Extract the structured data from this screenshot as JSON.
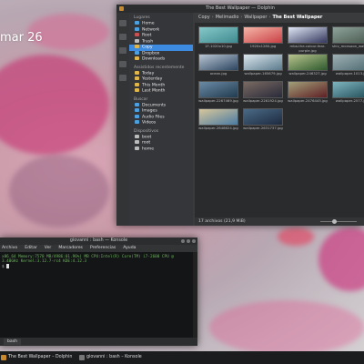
{
  "desktop": {
    "date_label": "mar 26"
  },
  "dolphin": {
    "title": "The Best Wallpaper — Dolphin",
    "places": [
      {
        "section": "Lugares",
        "items": [
          {
            "label": "Home",
            "icon": "home-icon",
            "color": "blue"
          },
          {
            "label": "Network",
            "icon": "network-icon",
            "color": "blue"
          },
          {
            "label": "Root",
            "icon": "root-folder-icon",
            "color": "red"
          },
          {
            "label": "Trash",
            "icon": "trash-icon",
            "color": "grey"
          },
          {
            "label": "Copy",
            "icon": "folder-icon",
            "color": "yellow",
            "selected": true
          },
          {
            "label": "Dropbox",
            "icon": "dropbox-icon",
            "color": "blue"
          },
          {
            "label": "Downloads",
            "icon": "downloads-icon",
            "color": "yellow"
          }
        ]
      },
      {
        "section": "Assistidos recentemente",
        "items": [
          {
            "label": "Today",
            "icon": "calendar-icon",
            "color": "yellow"
          },
          {
            "label": "Yesterday",
            "icon": "calendar-icon",
            "color": "yellow"
          },
          {
            "label": "This Month",
            "icon": "calendar-icon",
            "color": "yellow"
          },
          {
            "label": "Last Month",
            "icon": "calendar-icon",
            "color": "yellow"
          }
        ]
      },
      {
        "section": "Buscar",
        "items": [
          {
            "label": "Documents",
            "icon": "documents-icon",
            "color": "blue"
          },
          {
            "label": "Images",
            "icon": "images-icon",
            "color": "blue"
          },
          {
            "label": "Audio Files",
            "icon": "audio-icon",
            "color": "blue"
          },
          {
            "label": "Videos",
            "icon": "videos-icon",
            "color": "blue"
          }
        ]
      },
      {
        "section": "Dispositivos",
        "items": [
          {
            "label": "boot",
            "icon": "drive-icon",
            "color": "grey"
          },
          {
            "label": "root",
            "icon": "drive-icon",
            "color": "grey"
          },
          {
            "label": "home",
            "icon": "drive-icon",
            "color": "grey"
          }
        ]
      }
    ],
    "breadcrumb": [
      "Copy",
      "Melimadio",
      "Wallpaper",
      "The Best Wallpaper"
    ],
    "files": [
      {
        "caption": "1F-1020x10.jpg",
        "colors": [
          "#3f8a8f",
          "#86c8c9"
        ]
      },
      {
        "caption": "1920x1280.jpg",
        "colors": [
          "#c93f45",
          "#f5b6a8"
        ]
      },
      {
        "caption": "mba-the-colour-fear-purple.jpg",
        "colors": [
          "#33375c",
          "#dfe6f5"
        ]
      },
      {
        "caption": "shiv_monsoon_wallpaper.jpg",
        "colors": [
          "#49594f",
          "#8ea39a"
        ]
      },
      {
        "caption": "ocean.jpg",
        "colors": [
          "#2c4560",
          "#b9c6d4"
        ]
      },
      {
        "caption": "wallpaper-165679.jpg",
        "colors": [
          "#5a7a8c",
          "#dce7ee"
        ]
      },
      {
        "caption": "wallpaper-246327.jpg",
        "colors": [
          "#2e5a2e",
          "#b8c48e"
        ]
      },
      {
        "caption": "wallpaper-1013.jpg",
        "colors": [
          "#4f6b73",
          "#9eb0b3"
        ]
      },
      {
        "caption": "wallpaper-2267469.jpg",
        "colors": [
          "#213b4f",
          "#6b8ba6"
        ]
      },
      {
        "caption": "wallpaper-2261924.jpg",
        "colors": [
          "#292a3a",
          "#7a6a62"
        ]
      },
      {
        "caption": "wallpaper-2476445.jpg",
        "colors": [
          "#5e1f24",
          "#a2a07a"
        ]
      },
      {
        "caption": "wallpaper-2577.jpg",
        "colors": [
          "#214d58",
          "#7fb5bf"
        ]
      },
      {
        "caption": "wallpaper-2648624.jpg",
        "colors": [
          "#4a7ba3",
          "#d8c79b"
        ]
      },
      {
        "caption": "wallpaper-2631737.jpg",
        "colors": [
          "#1d2a3f",
          "#4a6a86"
        ]
      }
    ],
    "status": "17 archivos (21,9 MiB)"
  },
  "konsole": {
    "title": "giovanni : bash — Konsole",
    "menu": [
      "Archivo",
      "Editar",
      "Ver",
      "Marcadores",
      "Preferencias",
      "Ayuda"
    ],
    "line1": "x86_64 Memory:7578 MB/4986:01.96%) MB CPU:Intel(R) Core(TM) i7-2600 CPU @",
    "line2": "3.40GHz Kernel:3.12.7-rc4 KDE:4.12.3",
    "prompt": "$",
    "tab_label": "bash"
  },
  "taskbar": {
    "tasks": [
      {
        "label": "The Best Wallpaper – Dolphin",
        "color": "#c88a2c"
      },
      {
        "label": "giovanni : bash – Konsole",
        "color": "#777777"
      }
    ]
  }
}
